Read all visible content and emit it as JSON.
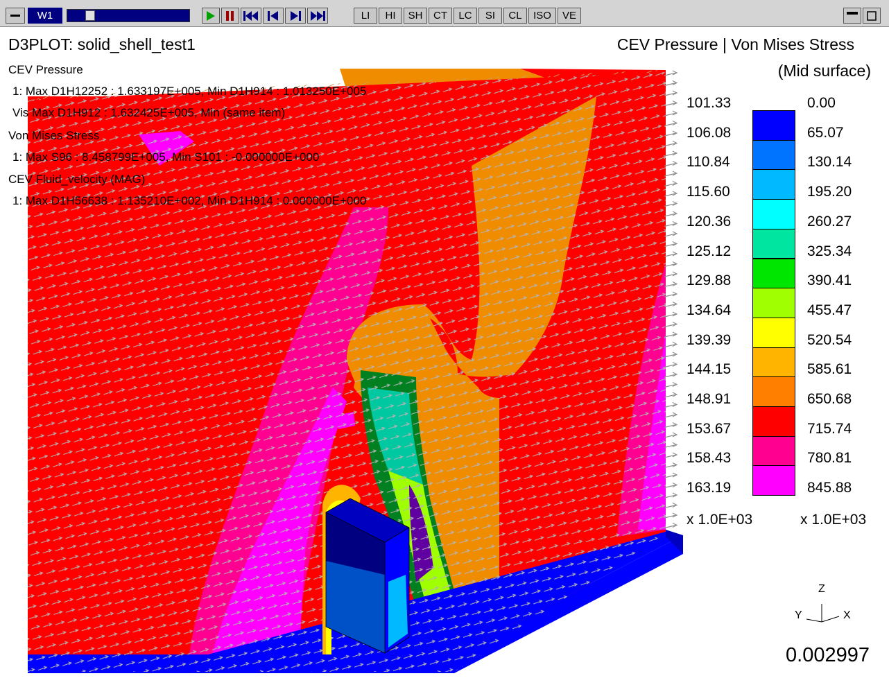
{
  "toolbar": {
    "window_label": "W1",
    "slider_value": 0.16,
    "mode_buttons": [
      "LI",
      "HI",
      "SH",
      "CT",
      "LC",
      "SI",
      "CL",
      "ISO",
      "VE"
    ],
    "icons": [
      "menu-icon",
      "play-icon",
      "pause-icon",
      "rewind-to-start-icon",
      "step-back-icon",
      "step-forward-icon",
      "forward-to-end-icon",
      "minimize-icon",
      "restore-icon"
    ]
  },
  "viewport": {
    "plot_title": "D3PLOT: solid_shell_test1",
    "contour_title": "CEV Pressure | Von Mises Stress",
    "surface_label": "(Mid surface)",
    "info_lines": [
      "CEV Pressure",
      "1: Max D1H12252 : 1.633197E+005, Min D1H914 : 1.013250E+005",
      "Vis Max D1H912 : 1.632425E+005, Min (same item)",
      "Von Mises Stress",
      "1: Max S96 : 8.458799E+005, Min S101 : -0.000000E+000",
      "CEV Fluid_velocity (MAG)",
      "1: Max D1H56638 : 1.135210E+002, Min D1H914 : 0.000000E+000"
    ],
    "time_value": "0.002997",
    "axes": {
      "z": "Z",
      "y": "Y",
      "x": "X"
    }
  },
  "legend": {
    "pressure_values": [
      "101.33",
      "106.08",
      "110.84",
      "115.60",
      "120.36",
      "125.12",
      "129.88",
      "134.64",
      "139.39",
      "144.15",
      "148.91",
      "153.67",
      "158.43",
      "163.19"
    ],
    "pressure_scale": "x 1.0E+03",
    "stress_values": [
      "0.00",
      "65.07",
      "130.14",
      "195.20",
      "260.27",
      "325.34",
      "390.41",
      "455.47",
      "520.54",
      "585.61",
      "650.68",
      "715.74",
      "780.81",
      "845.88"
    ],
    "stress_scale": "x 1.0E+03",
    "colors": [
      "#0000ff",
      "#0073ff",
      "#00b9ff",
      "#00ffff",
      "#00e6a0",
      "#00e600",
      "#a0ff00",
      "#ffff00",
      "#ffb400",
      "#ff8000",
      "#ff0000",
      "#ff0090",
      "#ff00ff"
    ]
  },
  "colors": {
    "window_label_bg": "#000080",
    "red": "#ff0000",
    "magenta": "#ff00ff",
    "pink": "#ff0090",
    "orange": "#f08c00",
    "blue": "#0000ff",
    "navy": "#000080",
    "arrow": "#a0a0a0"
  }
}
